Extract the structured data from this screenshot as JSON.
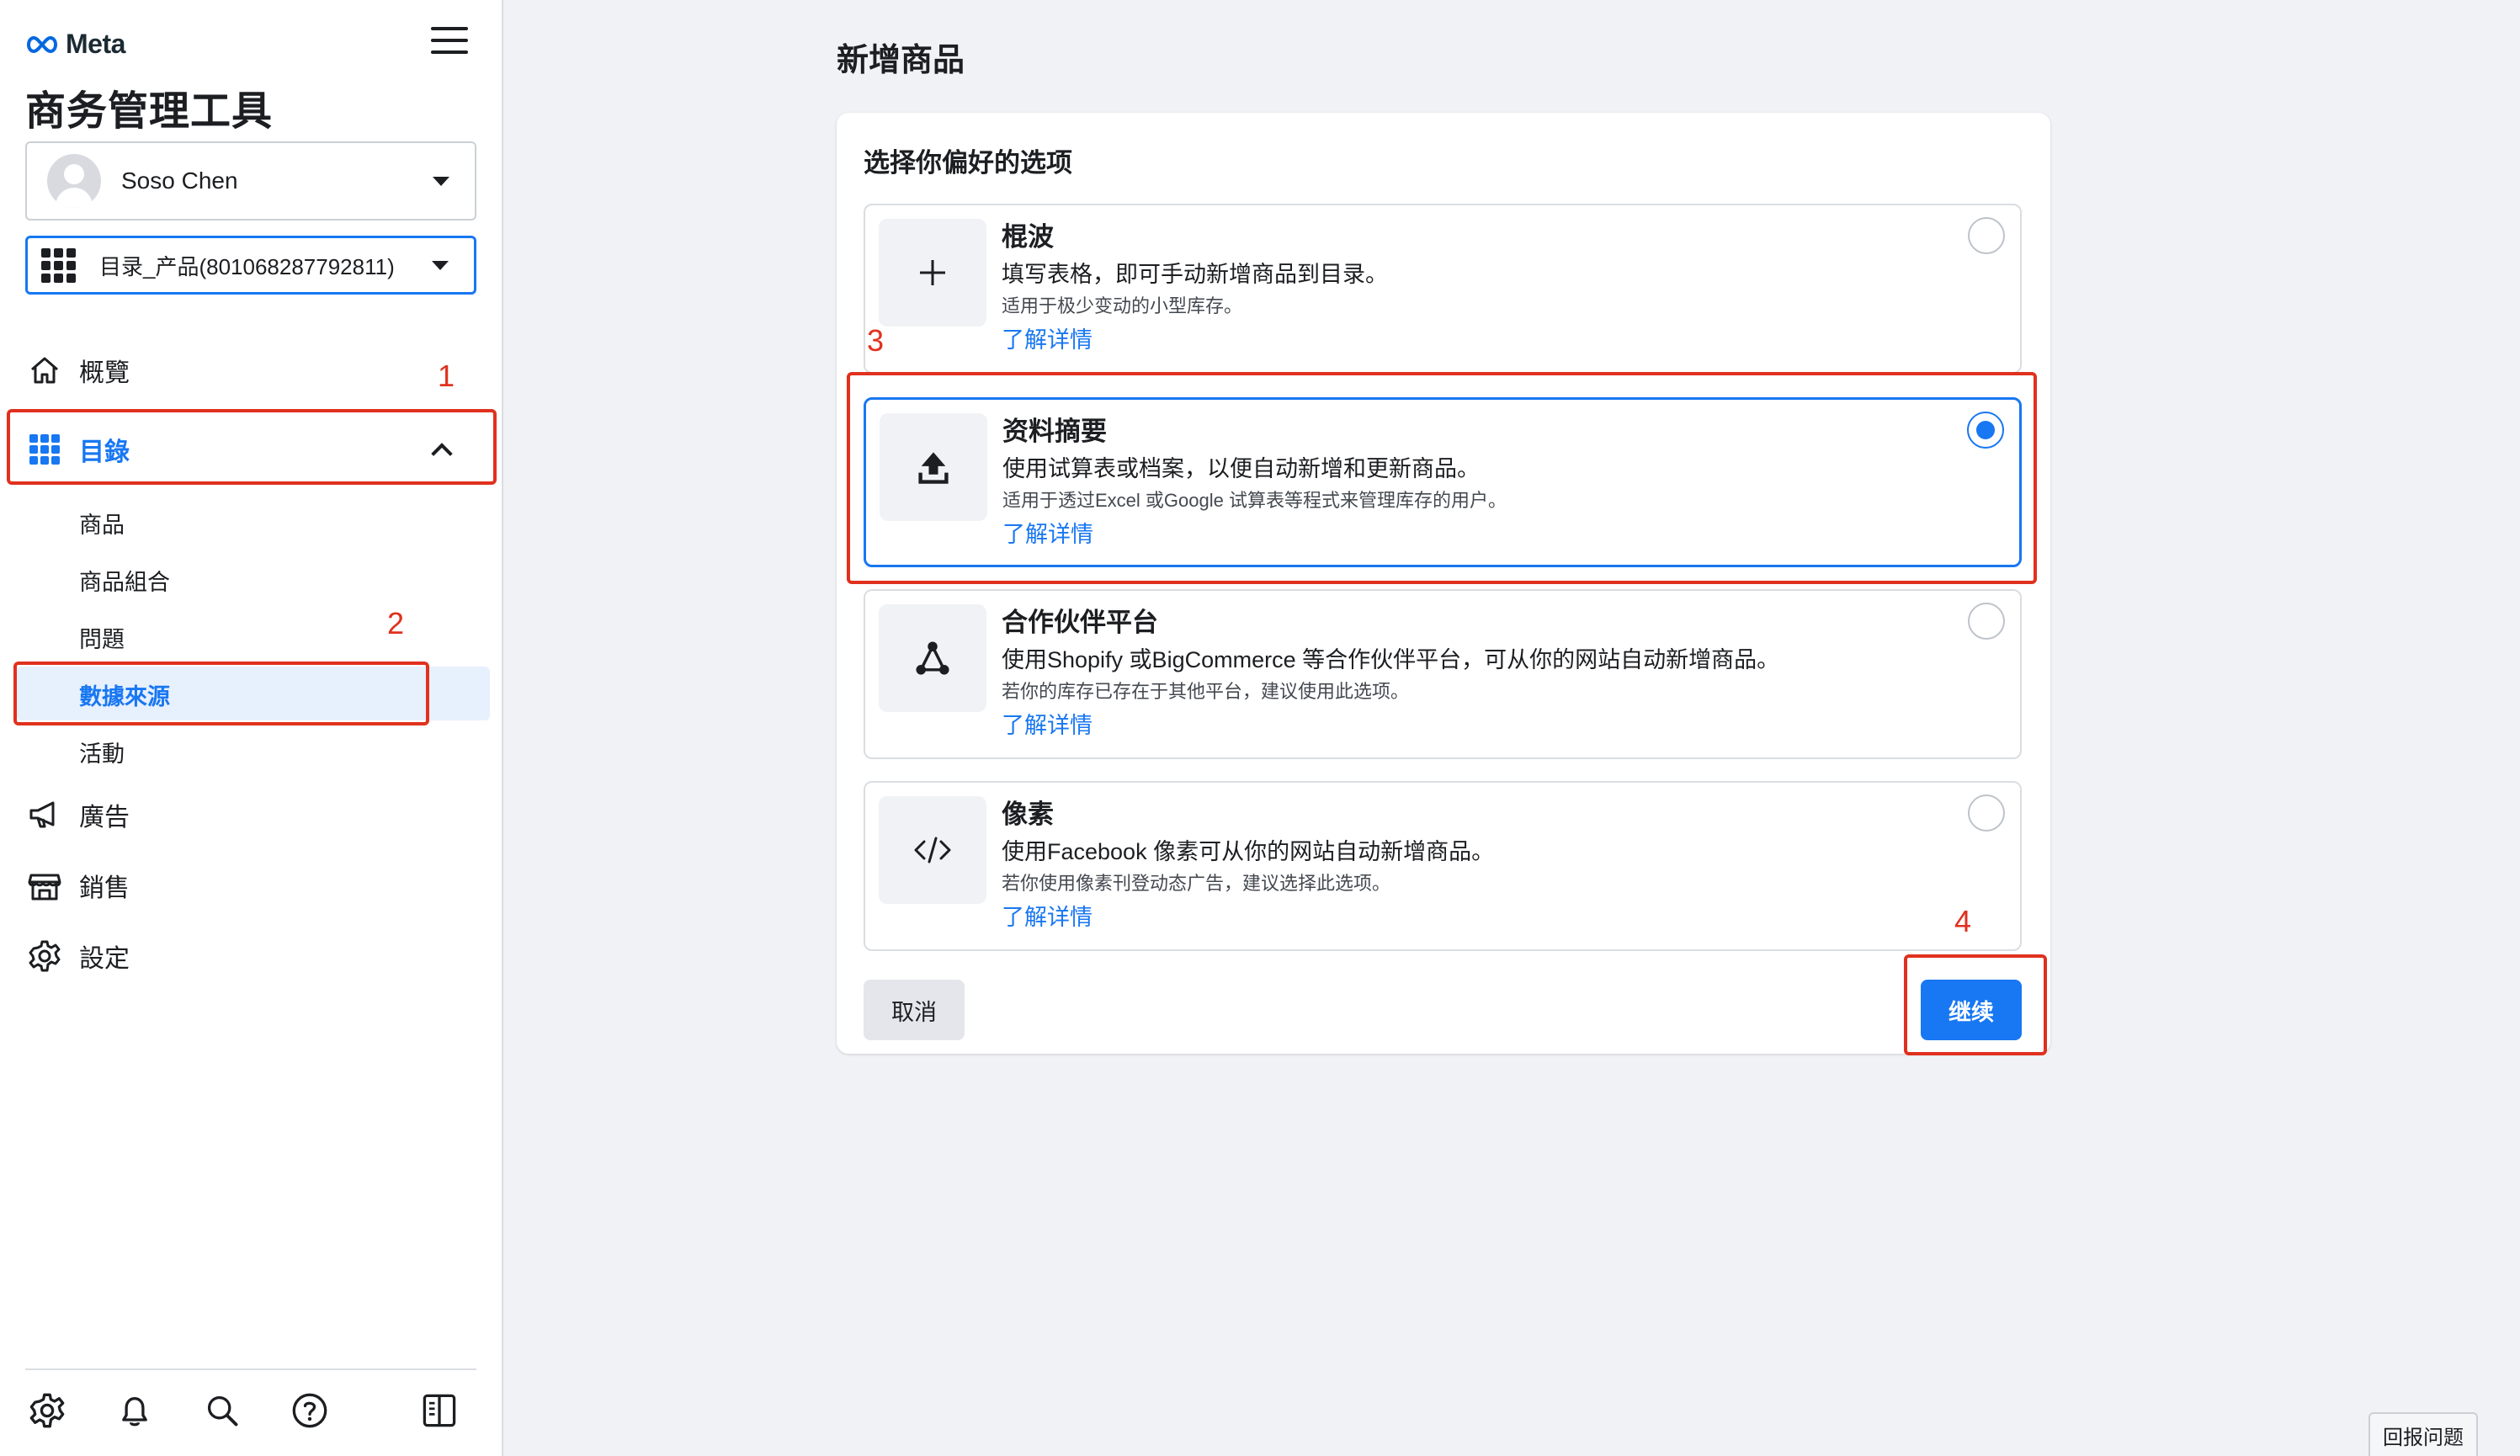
{
  "brand": {
    "logo_text": "Meta",
    "app_title": "商务管理工具"
  },
  "account": {
    "name": "Soso Chen"
  },
  "catalog_selector": {
    "value": "目录_产品(801068287792811)"
  },
  "nav": {
    "overview": "概覽",
    "catalog": "目錄",
    "catalog_sub": [
      "商品",
      "商品組合",
      "問題",
      "數據來源",
      "活動"
    ],
    "ads": "廣告",
    "sales": "銷售",
    "settings": "設定"
  },
  "main": {
    "page_title": "新增商品",
    "card_title": "选择你偏好的选项",
    "options": [
      {
        "title": "棍波",
        "desc": "填写表格，即可手动新增商品到目录。",
        "note": "适用于极少变动的小型库存。",
        "link": "了解详情",
        "selected": false,
        "icon": "plus-icon"
      },
      {
        "title": "资料摘要",
        "desc": "使用试算表或档案，以便自动新增和更新商品。",
        "note": "适用于透过Excel 或Google 试算表等程式来管理库存的用户。",
        "link": "了解详情",
        "selected": true,
        "icon": "upload-icon"
      },
      {
        "title": "合作伙伴平台",
        "desc": "使用Shopify 或BigCommerce 等合作伙伴平台，可从你的网站自动新增商品。",
        "note": "若你的库存已存在于其他平台，建议使用此选项。",
        "link": "了解详情",
        "selected": false,
        "icon": "network-icon"
      },
      {
        "title": "像素",
        "desc": "使用Facebook 像素可从你的网站自动新增商品。",
        "note": "若你使用像素刊登动态广告，建议选择此选项。",
        "link": "了解详情",
        "selected": false,
        "icon": "code-icon"
      }
    ],
    "cancel_label": "取消",
    "continue_label": "继续"
  },
  "annotations": [
    "1",
    "2",
    "3",
    "4"
  ],
  "report_label": "回报问题",
  "colors": {
    "accent": "#1877f2",
    "annotation": "#e0311e"
  }
}
